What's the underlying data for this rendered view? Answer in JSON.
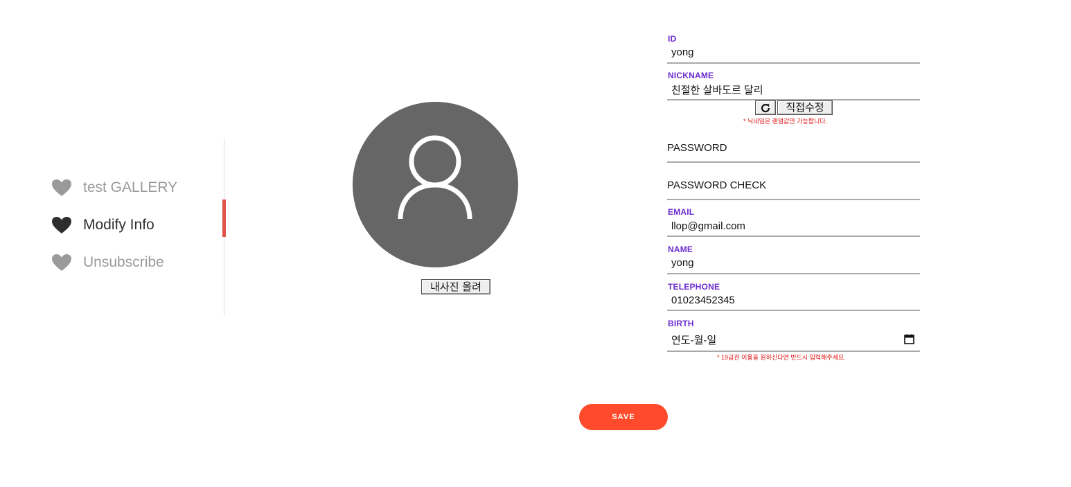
{
  "menu": {
    "items": [
      {
        "label": "test GALLERY",
        "active": false
      },
      {
        "label": "Modify Info",
        "active": true
      },
      {
        "label": "Unsubscribe",
        "active": false
      }
    ],
    "colors": {
      "inactive": "#9a9a9a",
      "active": "#2e2e2e",
      "indicator": "#e0534a"
    }
  },
  "profile": {
    "upload_label": "내사진 올려"
  },
  "form": {
    "id": {
      "label": "ID",
      "value": "yong"
    },
    "nickname": {
      "label": "NICKNAME",
      "value": "친절한 살바도르 달리",
      "edit_label": "직접수정",
      "note": "* 닉네임은 랜덤값만 가능합니다."
    },
    "password": {
      "label": "PASSWORD"
    },
    "password_check": {
      "label": "PASSWORD CHECK"
    },
    "email": {
      "label": "EMAIL",
      "value": "llop@gmail.com"
    },
    "name": {
      "label": "NAME",
      "value": "yong"
    },
    "telephone": {
      "label": "TELEPHONE",
      "value": "01023452345"
    },
    "birth": {
      "label": "BIRTH",
      "placeholder": "연도-월-일",
      "note": "* 19금관 이용을 원하신다면 반드시 입력해주세요."
    }
  },
  "save": {
    "label": "SAVE"
  },
  "colors": {
    "field_label": "#6b2bcf",
    "note": "#e01010",
    "save_button": "#ff4b2b",
    "avatar_bg": "#666666"
  }
}
